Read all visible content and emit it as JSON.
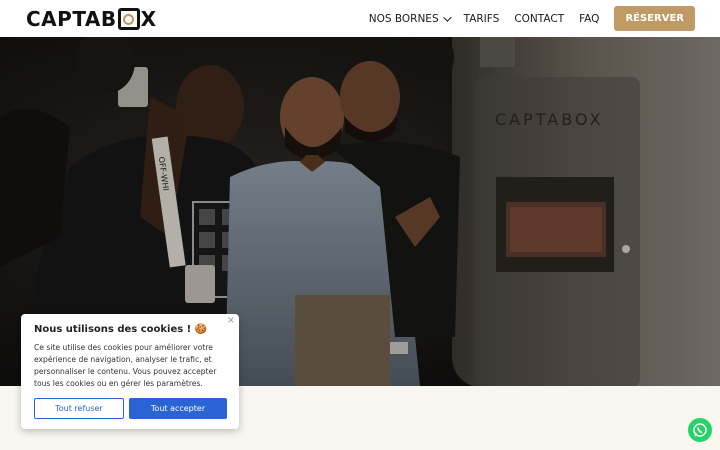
{
  "header": {
    "logo_text_left": "CAPTAB",
    "logo_text_right": "X",
    "nav": {
      "bornes": "NOS BORNES",
      "tarifs": "TARIFS",
      "contact": "CONTACT",
      "faq": "FAQ",
      "reserve": "RÉSERVER"
    },
    "chevron_icon": "chevron-down-icon"
  },
  "hero": {
    "booth_brand": "CAPTABOX",
    "shirt_text": "OFF-WHI"
  },
  "cookie": {
    "title": "Nous utilisons des cookies ! 🍪",
    "text": "Ce site utilise des cookies pour améliorer votre expérience de navigation, analyser le trafic, et personnaliser le contenu. Vous pouvez accepter tous les cookies ou en gérer les paramètres.",
    "close": "×",
    "refuse": "Tout refuser",
    "accept": "Tout accepter"
  },
  "whatsapp": {
    "icon": "whatsapp-icon",
    "color": "#25d366"
  },
  "colors": {
    "accent": "#c09a65",
    "cookie_button": "#2a64d4"
  }
}
